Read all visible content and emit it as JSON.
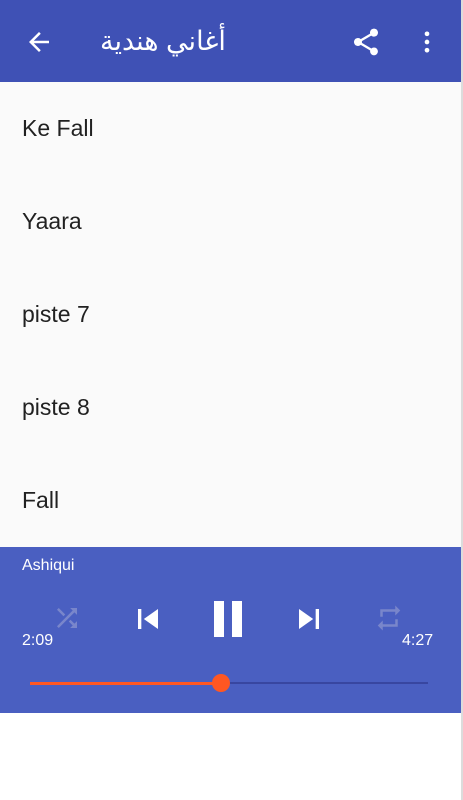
{
  "app_bar": {
    "title": "أغاني هندية",
    "icons": {
      "back": "arrow-back-icon",
      "share": "share-icon",
      "more": "more-vert-icon"
    },
    "color": "#3f51b5"
  },
  "songs": [
    {
      "title": "Ke Fall"
    },
    {
      "title": "Yaara"
    },
    {
      "title": "piste 7"
    },
    {
      "title": "piste 8"
    },
    {
      "title": "Fall"
    }
  ],
  "player": {
    "current_song": "Ashiqui",
    "elapsed": "2:09",
    "duration": "4:27",
    "progress": 0.48,
    "state": "playing",
    "shuffle_enabled": false,
    "repeat_enabled": false,
    "controls": [
      "shuffle-icon",
      "skip-previous-icon",
      "pause-icon",
      "skip-next-icon",
      "repeat-icon"
    ],
    "background_color": "#4a5fc1",
    "accent_color": "#ff5722"
  }
}
